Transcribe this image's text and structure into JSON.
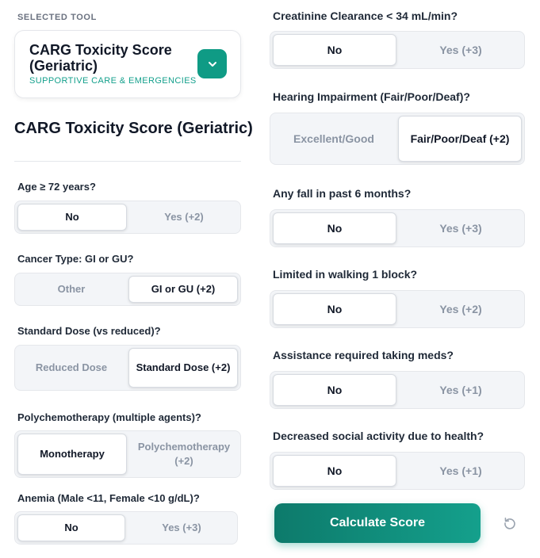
{
  "selected_tool": {
    "label": "SELECTED TOOL",
    "name": "CARG Toxicity Score (Geriatric)",
    "category": "SUPPORTIVE CARE & EMERGENCIES"
  },
  "title": "CARG Toxicity Score (Geriatric)",
  "questions": [
    {
      "label": "Age ≥ 72 years?",
      "options": [
        "No",
        "Yes (+2)"
      ],
      "selected": 0
    },
    {
      "label": "Cancer Type: GI or GU?",
      "options": [
        "Other",
        "GI or GU (+2)"
      ],
      "selected": 1
    },
    {
      "label": "Standard Dose (vs reduced)?",
      "options": [
        "Reduced Dose",
        "Standard Dose (+2)"
      ],
      "selected": 1
    },
    {
      "label": "Polychemotherapy (multiple agents)?",
      "options": [
        "Monotherapy",
        "Polychemotherapy (+2)"
      ],
      "selected": 0
    },
    {
      "label": "Anemia (Male <11, Female <10 g/dL)?",
      "options": [
        "No",
        "Yes (+3)"
      ],
      "selected": 0
    },
    {
      "label": "Creatinine Clearance < 34 mL/min?",
      "options": [
        "No",
        "Yes (+3)"
      ],
      "selected": 0
    },
    {
      "label": "Hearing Impairment (Fair/Poor/Deaf)?",
      "options": [
        "Excellent/Good",
        "Fair/Poor/Deaf (+2)"
      ],
      "selected": 1
    },
    {
      "label": "Any fall in past 6 months?",
      "options": [
        "No",
        "Yes (+3)"
      ],
      "selected": 0
    },
    {
      "label": "Limited in walking 1 block?",
      "options": [
        "No",
        "Yes (+2)"
      ],
      "selected": 0
    },
    {
      "label": "Assistance required taking meds?",
      "options": [
        "No",
        "Yes (+1)"
      ],
      "selected": 0
    },
    {
      "label": "Decreased social activity due to health?",
      "options": [
        "No",
        "Yes (+1)"
      ],
      "selected": 0
    }
  ],
  "calculate_label": "Calculate Score",
  "colors": {
    "accent": "#0f9b85",
    "accent_dark": "#0d7a6b"
  },
  "icons": {
    "dropdown": "chevron-down-icon",
    "reset": "refresh-icon"
  }
}
